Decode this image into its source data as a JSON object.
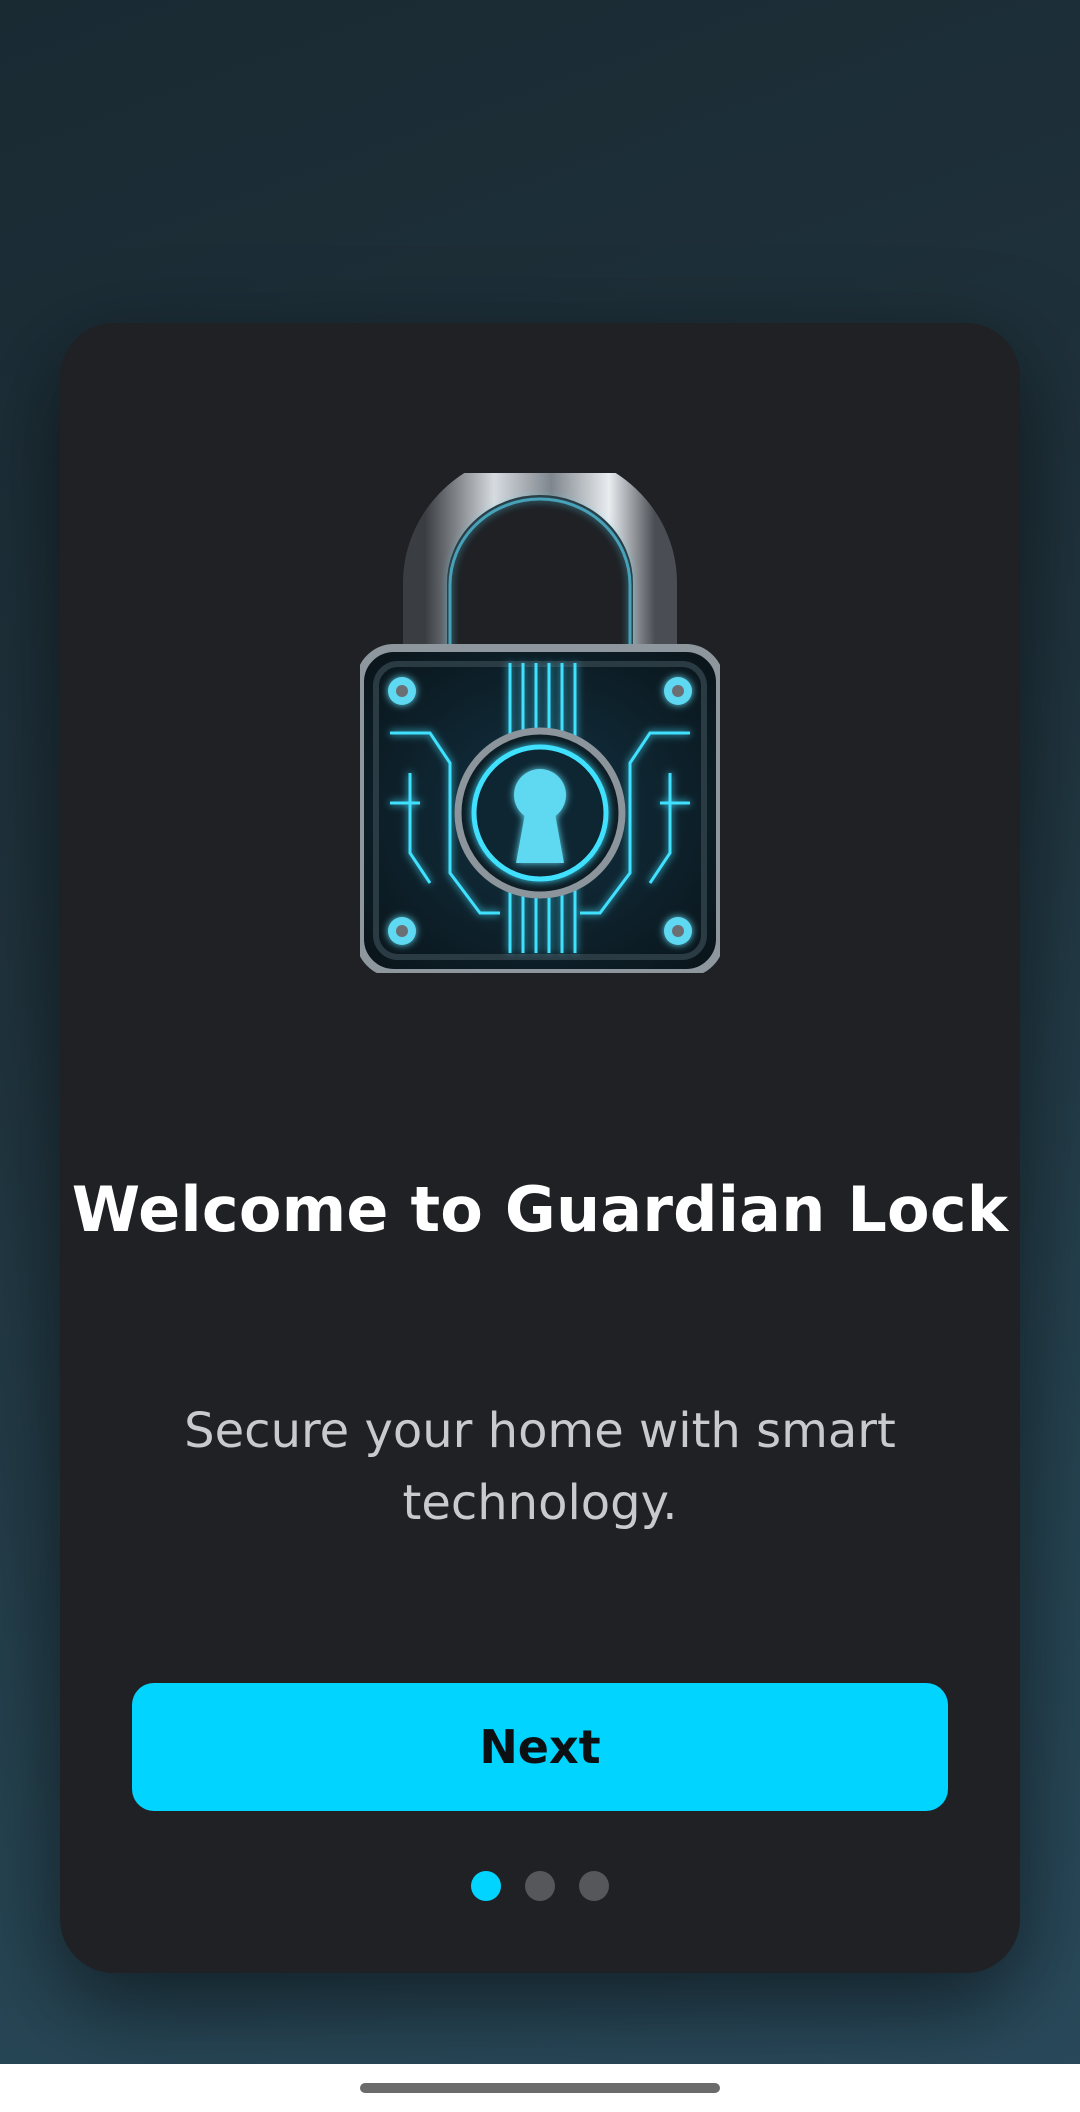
{
  "onboarding": {
    "title": "Welcome to Guardian Lock",
    "subtitle": "Secure your home with smart technology.",
    "next_label": "Next",
    "illustration": "padlock-circuit-icon",
    "current_step": 1,
    "total_steps": 3
  },
  "colors": {
    "accent": "#00d4ff",
    "card": "#1f2125",
    "dot_inactive": "#56575b"
  }
}
